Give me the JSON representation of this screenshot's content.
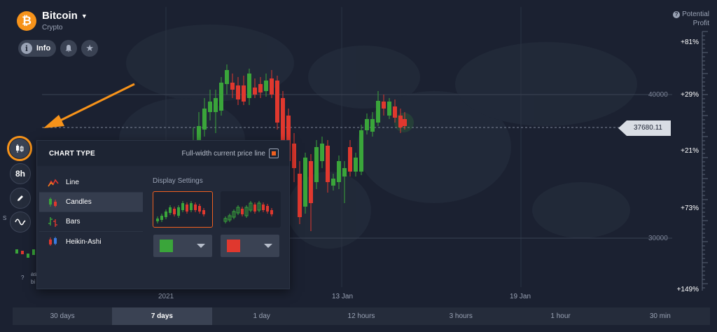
{
  "asset": {
    "name": "Bitcoin",
    "category": "Crypto",
    "coin_symbol": "₿"
  },
  "header_buttons": {
    "info_label": "Info",
    "info_glyph": "i"
  },
  "profit": {
    "line1": "Potential",
    "line2": "Profit"
  },
  "scale": {
    "percents": [
      "+81%",
      "+29%",
      "+21%",
      "+73%",
      "+149%"
    ],
    "prices": [
      "40000",
      "30000"
    ],
    "current_price": "37680.11"
  },
  "dates": [
    "2021",
    "13 Jan",
    "19 Jan"
  ],
  "toolbar": {
    "timeframe_label": "8h"
  },
  "popup": {
    "title": "CHART TYPE",
    "full_width_label": "Full-width current price line",
    "full_width_checked": true,
    "chart_types": [
      {
        "label": "Line",
        "icon": "line-chart-icon"
      },
      {
        "label": "Candles",
        "icon": "candles-icon",
        "active": true
      },
      {
        "label": "Bars",
        "icon": "bars-icon"
      },
      {
        "label": "Heikin-Ashi",
        "icon": "heikin-ashi-icon"
      }
    ],
    "display_settings_label": "Display Settings",
    "up_color": "#3aa53a",
    "down_color": "#e0382e"
  },
  "timeframes": [
    {
      "label": "30 days"
    },
    {
      "label": "7 days",
      "active": true
    },
    {
      "label": "1 day"
    },
    {
      "label": "12 hours"
    },
    {
      "label": "3 hours"
    },
    {
      "label": "1 hour"
    },
    {
      "label": "30 min"
    }
  ],
  "partial_text": {
    "line1": "as",
    "line2": "bi"
  },
  "colors": {
    "accent": "#f7931a",
    "background": "#1b2131",
    "checkbox": "#f06020"
  }
}
